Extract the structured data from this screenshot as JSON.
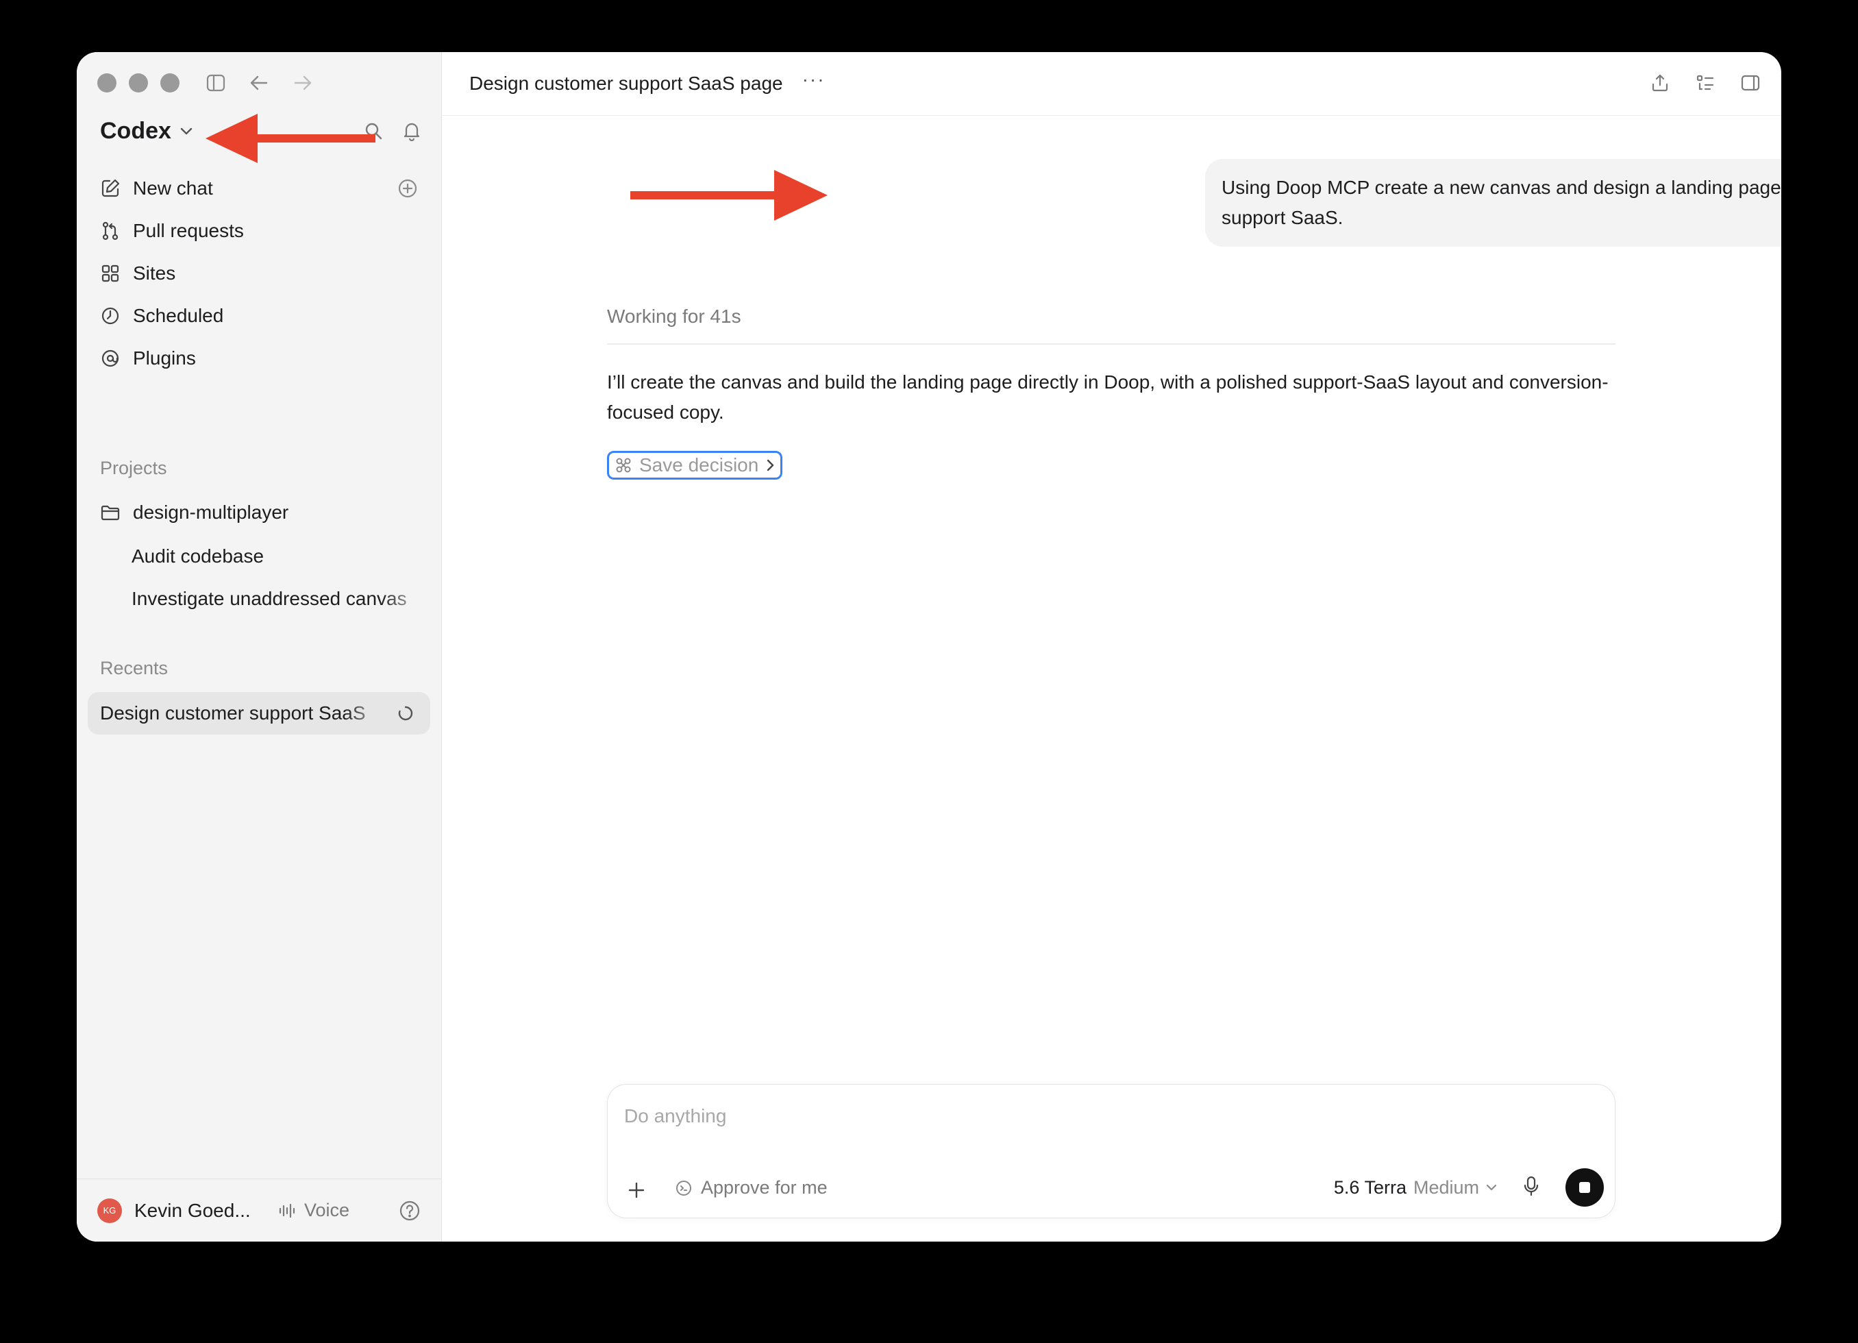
{
  "sidebar": {
    "brand": "Codex",
    "nav": [
      {
        "label": "New chat",
        "icon": "compose-icon"
      },
      {
        "label": "Pull requests",
        "icon": "pull-request-icon"
      },
      {
        "label": "Sites",
        "icon": "sites-icon"
      },
      {
        "label": "Scheduled",
        "icon": "clock-icon"
      },
      {
        "label": "Plugins",
        "icon": "plugin-icon"
      }
    ],
    "projects_label": "Projects",
    "project": "design-multiplayer",
    "project_children": [
      "Audit codebase",
      "Investigate unaddressed canvas"
    ],
    "recents_label": "Recents",
    "recent_active": "Design customer support SaaS",
    "footer": {
      "avatar_initials": "KG",
      "user_name": "Kevin Goed...",
      "voice_label": "Voice"
    }
  },
  "header": {
    "title": "Design customer support SaaS page",
    "more": "···"
  },
  "conversation": {
    "user_message": "Using Doop MCP create a new canvas and design a landing page for a customer support SaaS.",
    "working_status": "Working for 41s",
    "assistant_message": "I’ll create the canvas and build the landing page directly in Doop, with a polished support-SaaS layout and conversion-focused copy.",
    "save_decision_label": "Save decision"
  },
  "composer": {
    "placeholder": "Do anything",
    "approve_label": "Approve for me",
    "model_name": "5.6 Terra",
    "model_effort": "Medium"
  },
  "colors": {
    "annotation_arrow": "#e8412c",
    "focus_ring": "#3b82f6",
    "avatar": "#e0594a"
  }
}
